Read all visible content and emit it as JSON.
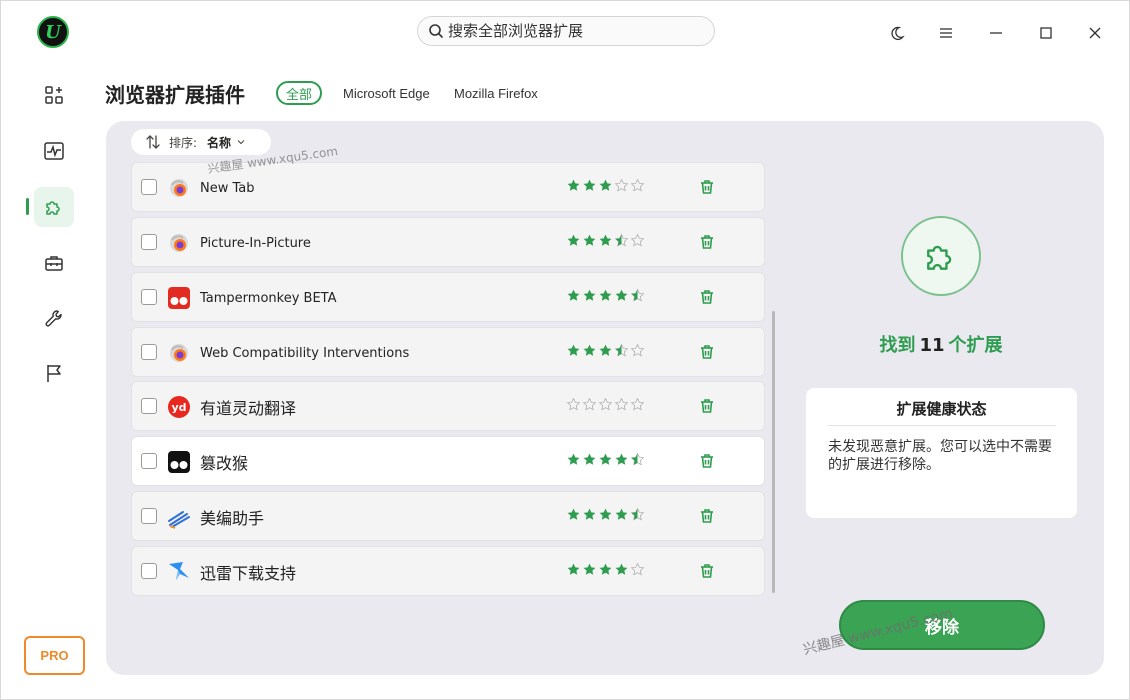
{
  "search": {
    "placeholder": "搜索全部浏览器扩展"
  },
  "header": {
    "title": "浏览器扩展插件",
    "tabs": [
      "全部",
      "Microsoft Edge",
      "Mozilla Firefox"
    ]
  },
  "sidebar": {
    "items": [
      "dashboard",
      "performance",
      "extensions",
      "toolbox",
      "tools",
      "flag"
    ],
    "active": "extensions",
    "pro_label": "PRO"
  },
  "sort": {
    "label": "排序:",
    "value": "名称"
  },
  "extensions": [
    {
      "name": "New Tab",
      "icon": "firefox-icon",
      "rating": 3,
      "selected": false
    },
    {
      "name": "Picture-In-Picture",
      "icon": "firefox-icon",
      "rating": 3.5,
      "selected": false
    },
    {
      "name": "Tampermonkey BETA",
      "icon": "tampermonkey-beta-icon",
      "rating": 4.5,
      "selected": false
    },
    {
      "name": "Web Compatibility Interventions",
      "icon": "firefox-icon",
      "rating": 3.5,
      "selected": false
    },
    {
      "name": "有道灵动翻译",
      "icon": "youdao-icon",
      "rating": 0,
      "selected": false
    },
    {
      "name": "篡改猴",
      "icon": "tampermonkey-icon",
      "rating": 4.5,
      "selected": true
    },
    {
      "name": "美编助手",
      "icon": "meibian-icon",
      "rating": 4.5,
      "selected": false
    },
    {
      "name": "迅雷下载支持",
      "icon": "xunlei-icon",
      "rating": 4,
      "selected": false
    }
  ],
  "summary": {
    "found_prefix": "找到",
    "found_count": "11",
    "found_suffix": "个扩展",
    "health_title": "扩展健康状态",
    "health_body": "未发现恶意扩展。您可以选中不需要的扩展进行移除。",
    "remove_label": "移除"
  },
  "watermarks": [
    "兴趣屋 www.xqu5.com",
    "兴趣屋 www.xqu5.com"
  ],
  "colors": {
    "accent": "#2e9d4f",
    "pro": "#ef8a2b",
    "panel": "#e9e9ef"
  }
}
